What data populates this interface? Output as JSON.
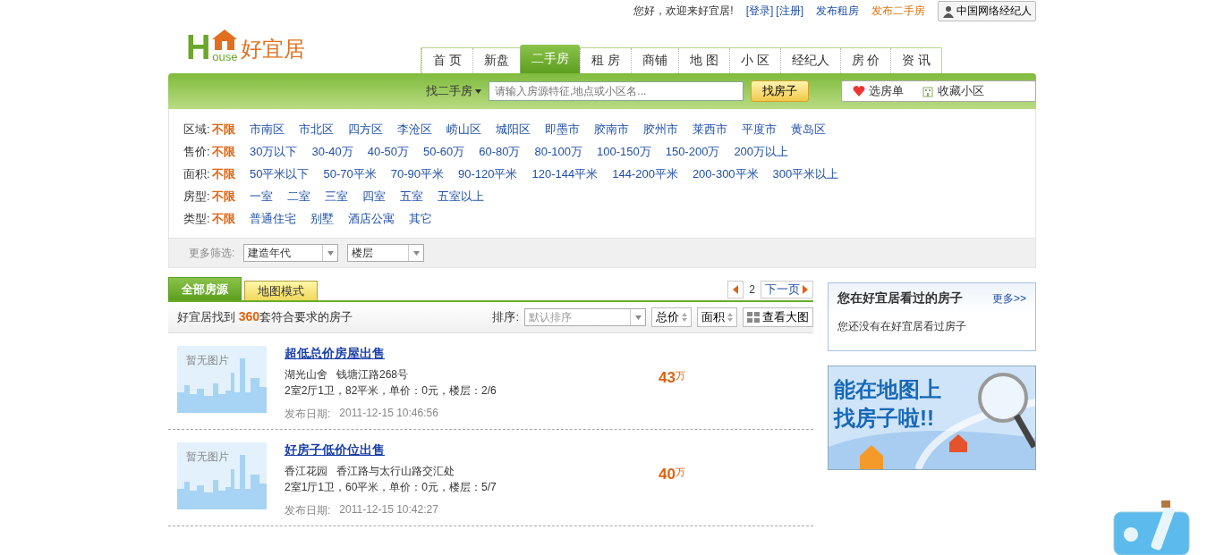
{
  "top_bar": {
    "greeting": "您好，欢迎来好宜居!",
    "account_links": [
      "[登录]",
      "[注册]"
    ],
    "post_links": [
      {
        "label": "发布租房",
        "highlighted": false
      },
      {
        "label": "发布二手房",
        "highlighted": true
      }
    ],
    "agent_button": "中国网络经纪人"
  },
  "logo": {
    "letter": "H",
    "word": "ouse",
    "name": "好宜居"
  },
  "nav": [
    {
      "label": "首 页",
      "selected": false
    },
    {
      "label": "新盘",
      "selected": false
    },
    {
      "label": "二手房",
      "selected": true
    },
    {
      "label": "租 房",
      "selected": false
    },
    {
      "label": "商铺",
      "selected": false
    },
    {
      "label": "地 图",
      "selected": false
    },
    {
      "label": "小 区",
      "selected": false
    },
    {
      "label": "经纪人",
      "selected": false
    },
    {
      "label": "房 价",
      "selected": false
    },
    {
      "label": "资 讯",
      "selected": false
    }
  ],
  "search": {
    "scope": "找二手房",
    "placeholder": "请输入房源特征,地点或小区名...",
    "button": "找房子",
    "shortcuts": [
      "选房单",
      "收藏小区"
    ]
  },
  "filters": [
    {
      "label": "区域:",
      "options": [
        {
          "text": "不限",
          "selected": true
        },
        {
          "text": "市南区",
          "selected": false
        },
        {
          "text": "市北区",
          "selected": false
        },
        {
          "text": "四方区",
          "selected": false
        },
        {
          "text": "李沧区",
          "selected": false
        },
        {
          "text": "崂山区",
          "selected": false
        },
        {
          "text": "城阳区",
          "selected": false
        },
        {
          "text": "即墨市",
          "selected": false
        },
        {
          "text": "胶南市",
          "selected": false
        },
        {
          "text": "胶州市",
          "selected": false
        },
        {
          "text": "莱西市",
          "selected": false
        },
        {
          "text": "平度市",
          "selected": false
        },
        {
          "text": "黄岛区",
          "selected": false
        }
      ]
    },
    {
      "label": "售价:",
      "options": [
        {
          "text": "不限",
          "selected": true
        },
        {
          "text": "30万以下",
          "selected": false
        },
        {
          "text": "30-40万",
          "selected": false
        },
        {
          "text": "40-50万",
          "selected": false
        },
        {
          "text": "50-60万",
          "selected": false
        },
        {
          "text": "60-80万",
          "selected": false
        },
        {
          "text": "80-100万",
          "selected": false
        },
        {
          "text": "100-150万",
          "selected": false
        },
        {
          "text": "150-200万",
          "selected": false
        },
        {
          "text": "200万以上",
          "selected": false
        }
      ]
    },
    {
      "label": "面积:",
      "options": [
        {
          "text": "不限",
          "selected": true
        },
        {
          "text": "50平米以下",
          "selected": false
        },
        {
          "text": "50-70平米",
          "selected": false
        },
        {
          "text": "70-90平米",
          "selected": false
        },
        {
          "text": "90-120平米",
          "selected": false
        },
        {
          "text": "120-144平米",
          "selected": false
        },
        {
          "text": "144-200平米",
          "selected": false
        },
        {
          "text": "200-300平米",
          "selected": false
        },
        {
          "text": "300平米以上",
          "selected": false
        }
      ]
    },
    {
      "label": "房型:",
      "options": [
        {
          "text": "不限",
          "selected": true
        },
        {
          "text": "一室",
          "selected": false
        },
        {
          "text": "二室",
          "selected": false
        },
        {
          "text": "三室",
          "selected": false
        },
        {
          "text": "四室",
          "selected": false
        },
        {
          "text": "五室",
          "selected": false
        },
        {
          "text": "五室以上",
          "selected": false
        }
      ]
    },
    {
      "label": "类型:",
      "options": [
        {
          "text": "不限",
          "selected": true
        },
        {
          "text": "普通住宅",
          "selected": false
        },
        {
          "text": "别墅",
          "selected": false
        },
        {
          "text": "酒店公寓",
          "selected": false
        },
        {
          "text": "其它",
          "selected": false
        }
      ]
    }
  ],
  "more_filters": {
    "label": "更多筛选:",
    "selects": [
      "建造年代",
      "楼层"
    ]
  },
  "result_tabs": [
    {
      "label": "全部房源",
      "selected": true
    },
    {
      "label": "地图模式",
      "selected": false
    }
  ],
  "pager": {
    "page": "2",
    "next": "下一页"
  },
  "summary": "好宜居找到 **360**套符合要求的房子",
  "sort": {
    "label": "排序:",
    "select": "默认排序",
    "buttons": [
      "总价",
      "面积"
    ],
    "view": "查看大图"
  },
  "listings": [
    {
      "title": "超低总价房屋出售",
      "image_text": "暂无图片",
      "community": "湖光山舍",
      "address": "钱塘江路268号",
      "details": "2室2厅1卫，82平米，单价：0元，楼层：2/6",
      "date_label": "发布日期:",
      "date": "2011-12-15 10:46:56",
      "price": "43",
      "unit": "万"
    },
    {
      "title": "好房子低价位出售",
      "image_text": "暂无图片",
      "community": "香江花园",
      "address": "香江路与太行山路交汇处",
      "details": "2室1厅1卫，60平米，单价：0元，楼层：5/7",
      "date_label": "发布日期:",
      "date": "2011-12-15 10:42:27",
      "price": "40",
      "unit": "万"
    }
  ],
  "sidebar": {
    "history": {
      "title": "您在好宜居看过的房子",
      "more": "更多>>",
      "empty": "您还没有在好宜居看过房子"
    },
    "banner": {
      "lines": [
        "能在地图上",
        "找房子啦!!"
      ]
    }
  }
}
